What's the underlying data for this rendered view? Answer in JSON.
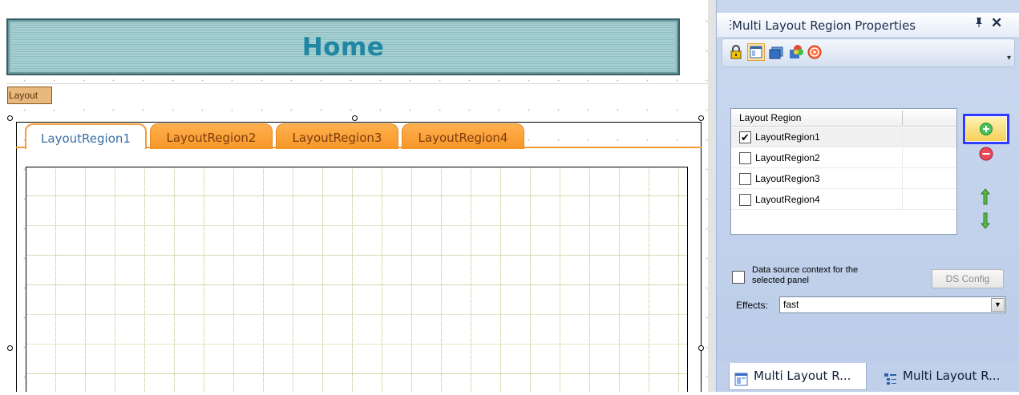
{
  "designer": {
    "banner_title": "Home",
    "layout_badge": "Layout",
    "tabs": [
      {
        "label": "LayoutRegion1",
        "active": true
      },
      {
        "label": "LayoutRegion2",
        "active": false
      },
      {
        "label": "LayoutRegion3",
        "active": false
      },
      {
        "label": "LayoutRegion4",
        "active": false
      }
    ]
  },
  "panel": {
    "title": "Multi Layout Region Properties",
    "pin_glyph": "ᵖ",
    "close_glyph": "✕",
    "toolbar": {
      "icons": [
        "lock-icon",
        "layout-icon",
        "card-icon",
        "effects-icon",
        "stop-icon"
      ]
    },
    "region_table": {
      "header": "Layout Region",
      "rows": [
        {
          "label": "LayoutRegion1",
          "checked": true
        },
        {
          "label": "LayoutRegion2",
          "checked": false
        },
        {
          "label": "LayoutRegion3",
          "checked": false
        },
        {
          "label": "LayoutRegion4",
          "checked": false
        }
      ]
    },
    "data_source_label": "Data source context for the selected panel",
    "data_source_checked": false,
    "ds_config_label": "DS Config",
    "effects_label": "Effects:",
    "effects_value": "fast",
    "bottom_tabs": [
      {
        "label": "Multi Layout R...",
        "active": true
      },
      {
        "label": "Multi Layout R...",
        "active": false
      }
    ]
  },
  "colors": {
    "tab_orange": "#f79628",
    "panel_bg": "#c8d7ee",
    "banner_teal": "#1f86a3",
    "add_button_border": "#2f3cff"
  }
}
